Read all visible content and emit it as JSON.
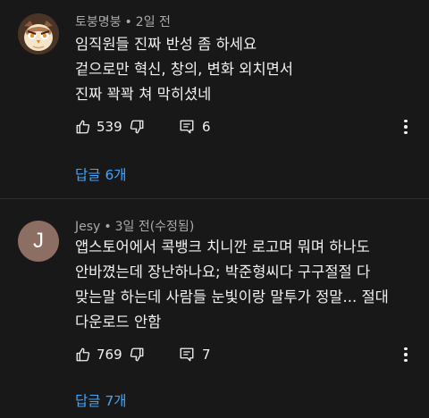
{
  "comments": [
    {
      "author": "토붕명붕",
      "time": "2일 전",
      "lines": [
        "임직원들 진짜 반성 좀 하세요",
        "겉으로만 혁신, 창의, 변화 외치면서",
        "진짜 꽉꽉 쳐 막히셨네"
      ],
      "likes": "539",
      "reply_count": "6",
      "replies_link": "답글 6개",
      "avatar_icon": "owl-avatar-icon"
    },
    {
      "author": "Jesy",
      "time": "3일 전(수정됨)",
      "avatar_letter": "J",
      "lines": [
        "앱스토어에서 콕뱅크 치니깐 로고며 뭐며 하나도",
        "안바꼈는데 장난하나요; 박준형씨다 구구절절 다",
        "맞는말 하는데 사람들 눈빛이랑 말투가 정말... 절대",
        "다운로드 안함"
      ],
      "likes": "769",
      "reply_count": "7",
      "replies_link": "답글 7개"
    }
  ],
  "separator": "•",
  "colors": {
    "background": "#181818",
    "link": "#3ea6ff",
    "meta": "#aaaaaa",
    "text": "#f1f1f1"
  }
}
